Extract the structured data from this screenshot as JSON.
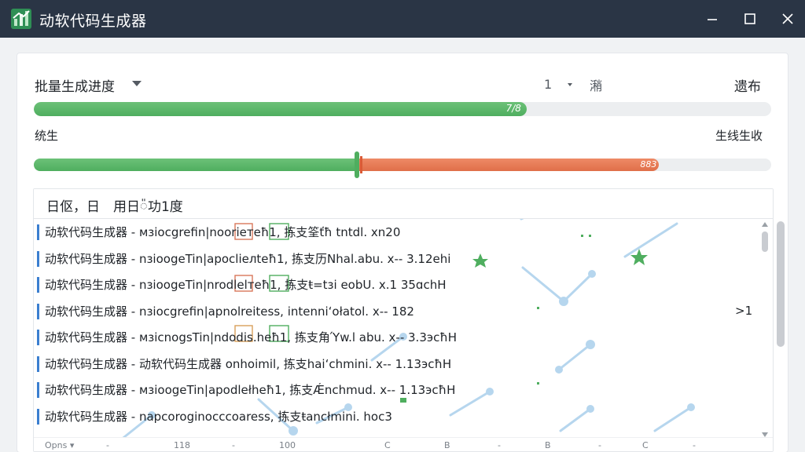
{
  "window": {
    "title": "动软代码生成器"
  },
  "toolbar": {
    "batch_label": "批量生成进度",
    "count_value": "1",
    "count_unit": "潲",
    "publish_label": "遗布"
  },
  "progress_primary": {
    "value_text": "7/8",
    "fraction": 0.668
  },
  "status": {
    "left_text": "统生",
    "right_text": "生线生收"
  },
  "progress_secondary": {
    "value_text": "883",
    "green_fraction": 0.438,
    "orange_fraction": 0.41
  },
  "list": {
    "header_text": "日伛，日　用日៉功1度",
    "rows": [
      {
        "text": "动软代码生成器 - мзiocgrefin|noorieтeħ1, 拣支筌ťħ tntdl.  xn20",
        "side": ""
      },
      {
        "text": "动软代码生成器 - nзioogeTin|apoclieлteħ1, 拣支历Νhal.abu.  x-- 3.12ehi",
        "side": ""
      },
      {
        "text": "动软代码生成器 - nзioogeTin|nrodlelтeħ1, 拣支ŧ=tзi eobU.  x.1 35ɑchH",
        "side": ""
      },
      {
        "text": "动软代码生成器 - nзiocgrefin|apnolreitess, intenniʻołatol.  x-- 182",
        "side": ">1"
      },
      {
        "text": "动软代码生成器 - мзicnogsTin|ndodis.heħ1, 拣支角Ύw.l abu.  x-- 3.3эcħH",
        "side": ""
      },
      {
        "text": "动软代码生成器 - 动软代码生成器 onhoimil, 拣支haiʻchmini.  x-- 1.13эcħH",
        "side": ""
      },
      {
        "text": "动软代码生成器 - мзioogeTin|apodlełheħ1, 拣支Ǽnchmud.  x-- 1.13эcħH",
        "side": ""
      },
      {
        "text": "动软代码生成器 - napcoroginocccoaress, 拣支ŧancłmini.  hoc3",
        "side": ""
      }
    ]
  },
  "footer": {
    "items": [
      "Opns ▾",
      "-",
      "118",
      "-",
      "100",
      "C",
      "B",
      "-",
      "B",
      "-",
      "C",
      "-"
    ]
  },
  "colors": {
    "titlebar": "#2a3545",
    "progress_green": "#4fae5f",
    "progress_orange": "#e06f49",
    "row_accent": "#3b7fd0",
    "deco_blue": "#a9cde9"
  }
}
